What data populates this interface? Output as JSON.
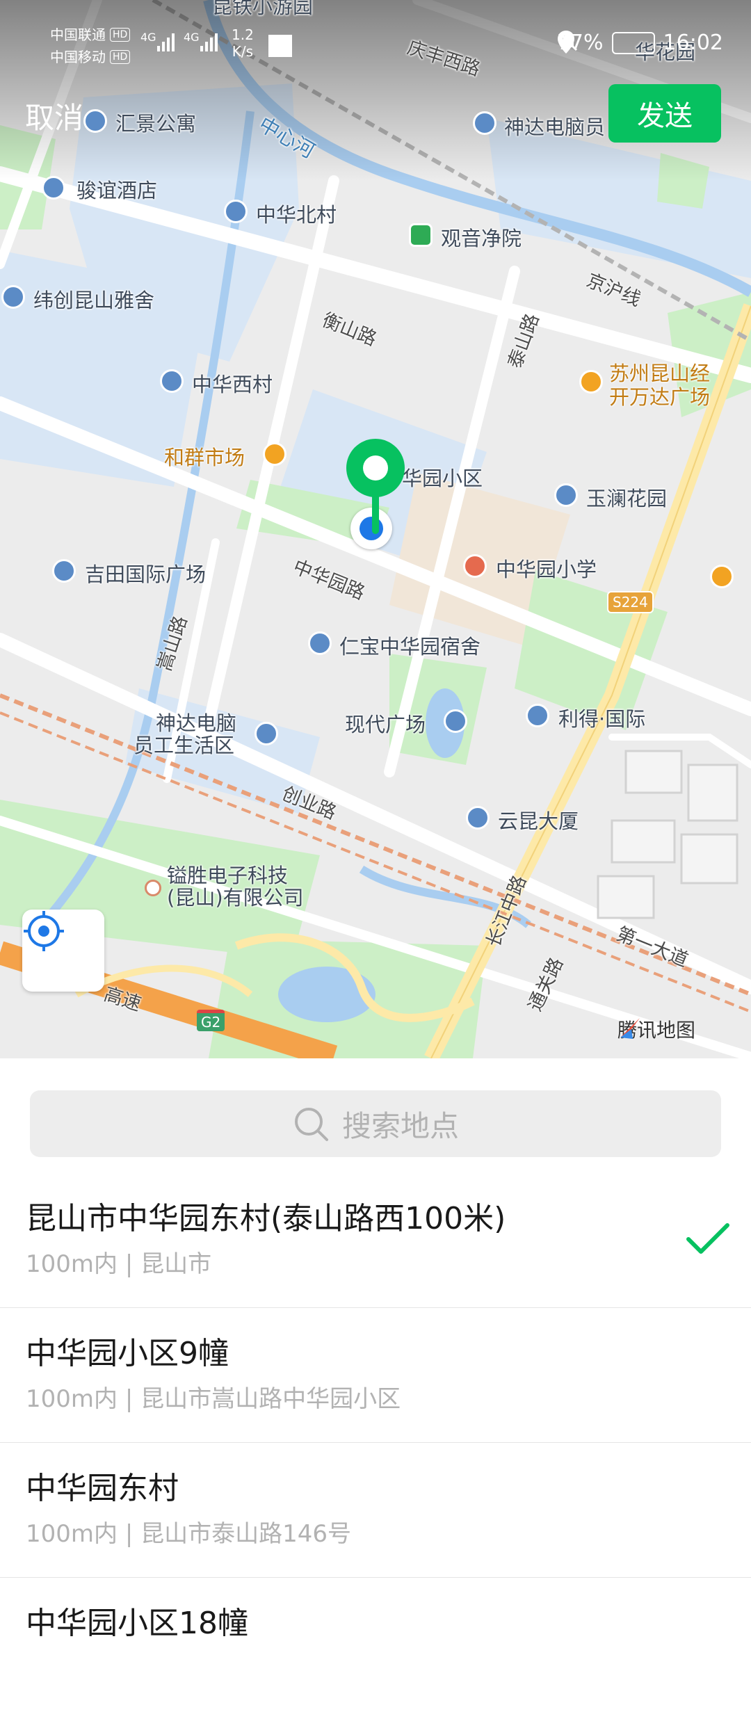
{
  "status_bar": {
    "carrier1": "中国联通",
    "carrier2": "中国移动",
    "hd": "HD",
    "net": "4G",
    "speed_value": "1.2",
    "speed_unit": "K/s",
    "battery": "77%",
    "time": "16:02"
  },
  "header": {
    "cancel_label": "取消",
    "send_label": "发送"
  },
  "map": {
    "labels": {
      "kunshan_youyou": "昆铁小游园",
      "qingfeng_road": "庆丰西路",
      "huijing": "汇景公寓",
      "shenda_top": "神达电脑员",
      "zhongxin_river": "中心河",
      "junyi": "骏谊酒店",
      "zhonghua_north": "中华北村",
      "guanyin": "观音净院",
      "jinghu_line": "京沪线",
      "weichuang": "纬创昆山雅舍",
      "hengshan_road": "衡山路",
      "taishan_road": "泰山路",
      "suzhou_wanda_1": "苏州昆山经",
      "suzhou_wanda_2": "开万达广场",
      "zhonghua_west": "中华西村",
      "hequn_market": "和群市场",
      "zhonghuayuan_xiaoqu": "华园小区",
      "yulan": "玉澜花园",
      "jitian": "吉田国际广场",
      "zhonghuayuan_road": "中华园路",
      "zhonghuayuan_school": "中华园小学",
      "songshan_road": "嵩山路",
      "rembao": "仁宝中华园宿舍",
      "shenda_1": "神达电脑",
      "shenda_2": "员工生活区",
      "modern_plaza": "现代广场",
      "lide": "利得·国际",
      "chuangye_road": "创业路",
      "yunkun": "云昆大厦",
      "yisheng_1": "镒胜电子科技",
      "yisheng_2": "(昆山)有限公司",
      "changjiang_road": "长江中路",
      "tongguan_road": "通关路",
      "diyi_avenue": "第一大道",
      "gaosu": "高速",
      "huake": "华花园"
    },
    "shields": {
      "s224": "S224",
      "g2": "G2"
    },
    "provider": "腾讯地图"
  },
  "search": {
    "placeholder": "搜索地点"
  },
  "results": [
    {
      "title": "昆山市中华园东村(泰山路西100米)",
      "subtitle": "100m内 | 昆山市",
      "selected": true
    },
    {
      "title": "中华园小区9幢",
      "subtitle": "100m内 | 昆山市嵩山路中华园小区",
      "selected": false
    },
    {
      "title": "中华园东村",
      "subtitle": "100m内 | 昆山市泰山路146号",
      "selected": false
    },
    {
      "title": "中华园小区18幢",
      "subtitle": "",
      "selected": false
    }
  ],
  "colors": {
    "accent": "#07c160",
    "pin": "#07c160",
    "location_dot": "#1e78e6"
  }
}
